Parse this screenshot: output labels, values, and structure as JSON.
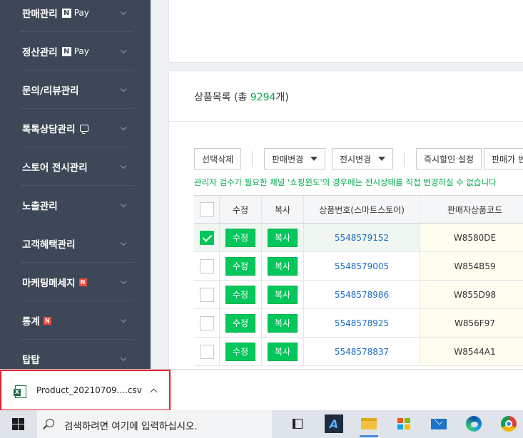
{
  "sidebar": {
    "items": [
      {
        "label": "판매관리",
        "extra": "N Pay"
      },
      {
        "label": "정산관리",
        "extra": "N Pay"
      },
      {
        "label": "문의/리뷰관리"
      },
      {
        "label": "톡톡상담관리"
      },
      {
        "label": "스토어 전시관리"
      },
      {
        "label": "노출관리"
      },
      {
        "label": "고객혜택관리"
      },
      {
        "label": "마케팅메세지",
        "badge": "N"
      },
      {
        "label": "통계",
        "badge": "N"
      },
      {
        "label": "탑탑"
      }
    ],
    "npay_n": "N",
    "npay_pay": "Pay"
  },
  "product_list": {
    "title_prefix": "상품목록 (총 ",
    "count": "9294",
    "title_suffix": "개)",
    "toolbar": {
      "delete_selected": "선택삭제",
      "change_sale": "판매변경",
      "change_display": "전시변경",
      "instant_discount": "즉시할인 설정",
      "sale_price_partial": "판매가 변"
    },
    "notice": "관리자 검수가 필요한 채널 '쇼핑윈도'의 경우에는 전시상태를 직접 변경하실 수 없습니다",
    "columns": [
      "",
      "수정",
      "복사",
      "상품번호(스마트스토어)",
      "판매자상품코드"
    ],
    "edit_label": "수정",
    "copy_label": "복사",
    "rows": [
      {
        "checked": true,
        "product_no": "5548579152",
        "seller_code": "W8580DE"
      },
      {
        "checked": false,
        "product_no": "5548579005",
        "seller_code": "W854B59"
      },
      {
        "checked": false,
        "product_no": "5548578986",
        "seller_code": "W855D98"
      },
      {
        "checked": false,
        "product_no": "5548578925",
        "seller_code": "W856F97"
      },
      {
        "checked": false,
        "product_no": "5548578837",
        "seller_code": "W8544A1"
      }
    ]
  },
  "download": {
    "file_name": "Product_20210709....csv",
    "icon": "excel-file-icon"
  },
  "taskbar": {
    "search_placeholder": "검색하려면 여기에 입력하십시오.",
    "apps": [
      "task-view-icon",
      "autodesk-a-icon",
      "file-explorer-icon",
      "store-icon",
      "mail-icon",
      "edge-icon",
      "chrome-icon"
    ]
  },
  "colors": {
    "sidebar_bg": "#3d4757",
    "accent_green": "#03c75a",
    "notice_green": "#03a94d",
    "link_blue": "#1a6bc9",
    "highlight_red": "#e51f2b"
  }
}
